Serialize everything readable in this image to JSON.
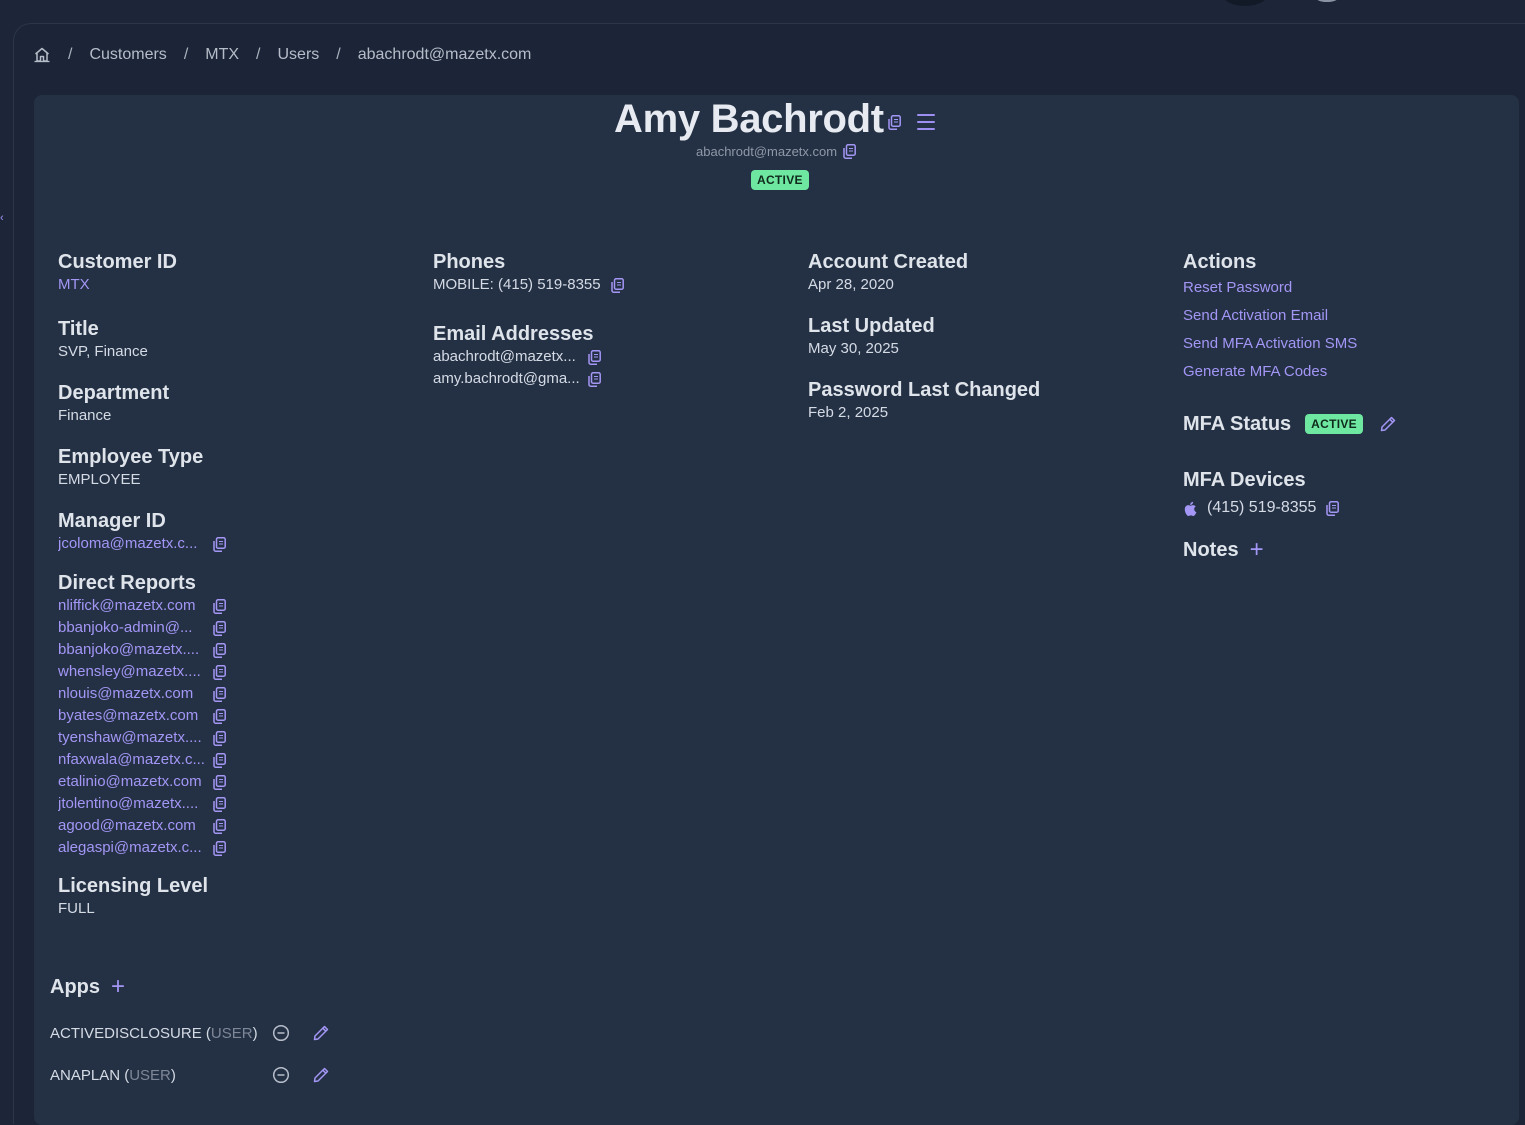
{
  "breadcrumb": {
    "items": [
      "Customers",
      "MTX",
      "Users",
      "abachrodt@mazetx.com"
    ],
    "separator": "/"
  },
  "user": {
    "name": "Amy Bachrodt",
    "email": "abachrodt@mazetx.com",
    "status": "ACTIVE"
  },
  "profile": {
    "customer_id_label": "Customer ID",
    "customer_id": "MTX",
    "title_label": "Title",
    "title": "SVP, Finance",
    "department_label": "Department",
    "department": "Finance",
    "employee_type_label": "Employee Type",
    "employee_type": "EMPLOYEE",
    "manager_id_label": "Manager ID",
    "manager_id": "jcoloma@mazetx.c...",
    "direct_reports_label": "Direct Reports",
    "direct_reports": [
      "nliffick@mazetx.com",
      "bbanjoko-admin@...",
      "bbanjoko@mazetx....",
      "whensley@mazetx....",
      "nlouis@mazetx.com",
      "byates@mazetx.com",
      "tyenshaw@mazetx....",
      "nfaxwala@mazetx.c...",
      "etalinio@mazetx.com",
      "jtolentino@mazetx....",
      "agood@mazetx.com",
      "alegaspi@mazetx.c..."
    ],
    "licensing_level_label": "Licensing Level",
    "licensing_level": "FULL"
  },
  "contact": {
    "phones_label": "Phones",
    "phone": "MOBILE: (415) 519-8355",
    "emails_label": "Email Addresses",
    "emails": [
      "abachrodt@mazetx...",
      "amy.bachrodt@gma..."
    ]
  },
  "account": {
    "created_label": "Account Created",
    "created": "Apr 28, 2020",
    "updated_label": "Last Updated",
    "updated": "May 30, 2025",
    "password_label": "Password Last Changed",
    "password": "Feb 2, 2025"
  },
  "actions": {
    "label": "Actions",
    "items": [
      "Reset Password",
      "Send Activation Email",
      "Send MFA Activation SMS",
      "Generate MFA Codes"
    ],
    "mfa_status_label": "MFA Status",
    "mfa_status": "ACTIVE",
    "mfa_devices_label": "MFA Devices",
    "mfa_device": "(415) 519-8355",
    "notes_label": "Notes"
  },
  "apps": {
    "label": "Apps",
    "items": [
      {
        "name": "ACTIVEDISCLOSURE",
        "role": "USER"
      },
      {
        "name": "ANAPLAN",
        "role": "USER"
      }
    ]
  },
  "colors": {
    "accent": "#a396f5",
    "badge": "#6ee7a0",
    "card": "#243145",
    "background": "#1c2638"
  },
  "icons": {
    "home": "home-icon",
    "copy": "copy-icon",
    "menu": "hamburger-menu-icon",
    "edit": "pencil-icon",
    "remove": "minus-circle-icon",
    "add": "plus-icon",
    "device": "apple-icon"
  }
}
